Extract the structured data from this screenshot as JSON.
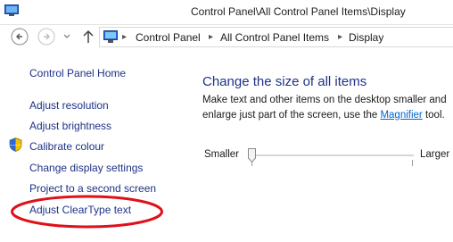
{
  "window": {
    "title": "Control Panel\\All Control Panel Items\\Display"
  },
  "address_bar": {
    "crumbs": [
      "Control Panel",
      "All Control Panel Items",
      "Display"
    ]
  },
  "sidebar": {
    "home": "Control Panel Home",
    "links": [
      "Adjust resolution",
      "Adjust brightness",
      "Calibrate colour",
      "Change display settings",
      "Project to a second screen",
      "Adjust ClearType text"
    ]
  },
  "main": {
    "heading": "Change the size of all items",
    "line1": "Make text and other items on the desktop smaller and",
    "line2_prefix": "enlarge just part of the screen, use the ",
    "magnifier_link": "Magnifier",
    "line2_suffix": " tool.",
    "slider": {
      "min_label": "Smaller",
      "max_label": "Larger",
      "value": 0
    }
  },
  "colors": {
    "link": "#1e3287",
    "accent_link": "#0066cc",
    "highlight": "#e0101a"
  },
  "icons": [
    "control-panel-icon",
    "back-icon",
    "forward-icon",
    "up-icon",
    "address-monitor-icon",
    "uac-shield-icon"
  ]
}
